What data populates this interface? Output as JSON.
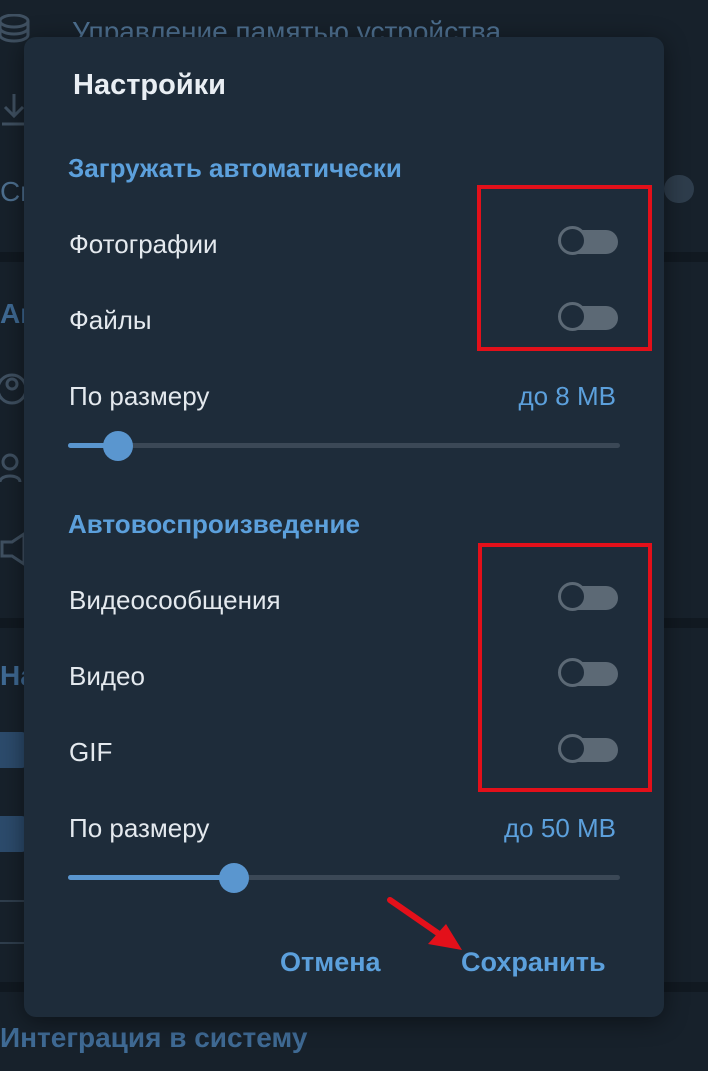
{
  "background": {
    "memory_label": "Управление памятью устройства",
    "partial_row_text": "Сп",
    "section_a_partial": "Ав",
    "section_n_partial": "На",
    "integration_label": "Интеграция в систему"
  },
  "dialog": {
    "title": "Настройки",
    "autodownload": {
      "header": "Загружать автоматически",
      "items": [
        {
          "label": "Фотографии",
          "on": false
        },
        {
          "label": "Файлы",
          "on": false
        }
      ],
      "size_label": "По размеру",
      "size_value": "до 8 MB",
      "slider_fraction": 0.09
    },
    "autoplay": {
      "header": "Автовоспроизведение",
      "items": [
        {
          "label": "Видеосообщения",
          "on": false
        },
        {
          "label": "Видео",
          "on": false
        },
        {
          "label": "GIF",
          "on": false
        }
      ],
      "size_label": "По размеру",
      "size_value": "до 50 MB",
      "slider_fraction": 0.3
    },
    "buttons": {
      "cancel": "Отмена",
      "save": "Сохранить"
    }
  },
  "colors": {
    "accent": "#5ca0dc",
    "dialog_bg": "#1e2c3a",
    "highlight": "#e3101a"
  }
}
